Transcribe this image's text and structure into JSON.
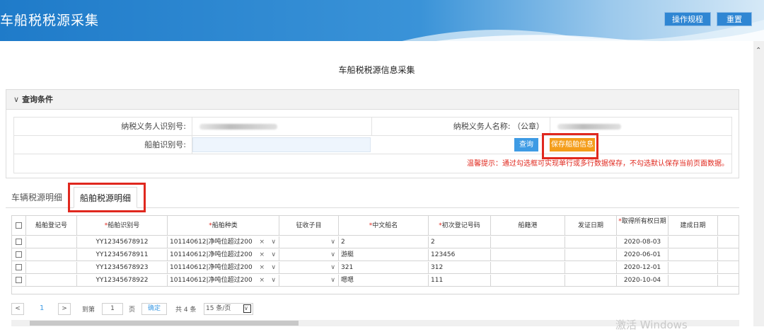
{
  "header": {
    "title": "车船税税源采集",
    "rules_label": "操作规程",
    "reset_label": "重置"
  },
  "page_title": "车船税税源信息采集",
  "query": {
    "section_label": "查询条件",
    "taxpayer_id_label": "纳税义务人识别号:",
    "taxpayer_name_label": "纳税义务人名称: （公章）",
    "ship_id_label": "船舶识别号:",
    "query_btn": "查询",
    "save_btn": "保存船舶信息",
    "hint": "温馨提示：通过勾选框可实现单行或多行数据保存，不勾选默认保存当前页面数据。"
  },
  "tabs": [
    {
      "label": "车辆税源明细"
    },
    {
      "label": "船舶税源明细"
    }
  ],
  "grid": {
    "columns": [
      "船舶登记号",
      "船舶识别号",
      "船舶种类",
      "征收子目",
      "中文船名",
      "初次登记号码",
      "船籍港",
      "发证日期",
      "取得所有权日期",
      "建成日期"
    ],
    "required_mark": "*",
    "rows": [
      {
        "reg": "",
        "ship_id": "YY12345678912",
        "type": "101140612|净吨位超过200",
        "sub": "",
        "name": "2",
        "first_reg": "2",
        "port": "",
        "issue": "",
        "own_date": "2020-08-03",
        "built": ""
      },
      {
        "reg": "",
        "ship_id": "YY12345678911",
        "type": "101140612|净吨位超过200",
        "sub": "",
        "name": "游艇",
        "first_reg": "123456",
        "port": "",
        "issue": "",
        "own_date": "2020-06-01",
        "built": ""
      },
      {
        "reg": "",
        "ship_id": "YY12345678923",
        "type": "101140612|净吨位超过200",
        "sub": "",
        "name": "321",
        "first_reg": "312",
        "port": "",
        "issue": "",
        "own_date": "2020-12-01",
        "built": ""
      },
      {
        "reg": "",
        "ship_id": "YY12345678922",
        "type": "101140612|净吨位超过200",
        "sub": "",
        "name": "嗯嗯",
        "first_reg": "111",
        "port": "",
        "issue": "",
        "own_date": "2020-10-04",
        "built": ""
      }
    ]
  },
  "pager": {
    "prev": "<",
    "current": "1",
    "next": ">",
    "goto_label": "到第",
    "page_value": "1",
    "page_unit": "页",
    "confirm": "确定",
    "total": "共 4 条",
    "page_size": "15 条/页"
  },
  "watermark": "激活 Windows"
}
